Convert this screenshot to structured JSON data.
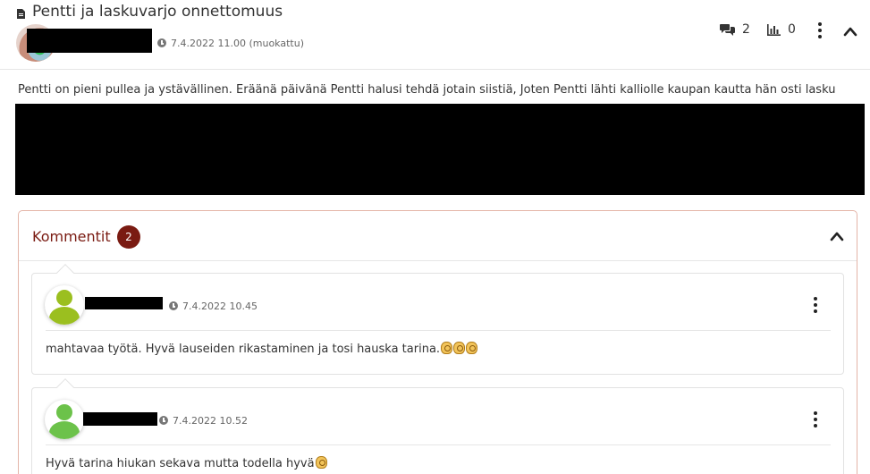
{
  "post": {
    "title": "Pentti ja laskuvarjo onnettomuus",
    "timestamp": "7.4.2022 11.00 (muokattu)",
    "comment_count": "2",
    "stats_count": "0",
    "body": "Pentti on pieni pullea ja ystävällinen. Eräänä päivänä Pentti halusi tehdä jotain siistiä, Joten Pentti lähti kalliolle kaupan kautta hän osti lasku"
  },
  "comments": {
    "title": "Kommentit",
    "count": "2",
    "items": [
      {
        "timestamp": "7.4.2022 10.45",
        "text": "mahtavaa työtä. Hyvä lauseiden rikastaminen ja tosi hauska tarina.",
        "emoji_icon": "ok-hand-emoji"
      },
      {
        "timestamp": "7.4.2022 10.52",
        "text": "Hyvä tarina hiukan sekava mutta todella hyvä",
        "emoji_icon": "ok-hand-emoji"
      }
    ]
  },
  "colors": {
    "accent": "#7a1b12",
    "panel_border": "#e4b5a8",
    "avatar_green_1": "#9bbf1f",
    "avatar_green_2": "#6cc24a"
  }
}
